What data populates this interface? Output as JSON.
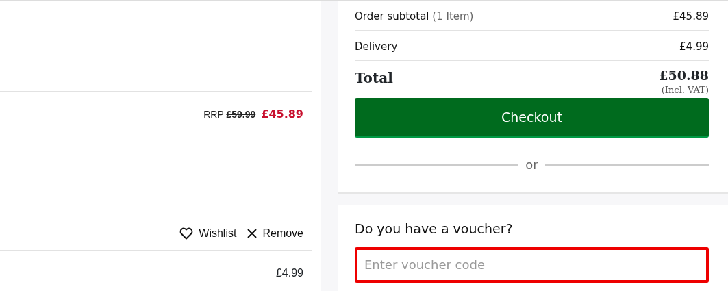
{
  "basket": {
    "item": {
      "rrp_label": "RRP",
      "rrp": "£59.99",
      "price": "£45.89",
      "actions": [
        {
          "kind": "wishlist",
          "label": "Wishlist"
        },
        {
          "kind": "remove",
          "label": "Remove"
        }
      ]
    },
    "delivery_price": "£4.99"
  },
  "summary": {
    "rows": [
      {
        "label": "Order subtotal",
        "note": "(1 Item)",
        "value": "£45.89"
      },
      {
        "label": "Delivery",
        "value": "£4.99"
      }
    ],
    "total": {
      "label": "Total",
      "value": "£50.88",
      "note": "(Incl. VAT)"
    },
    "checkout": "Checkout",
    "separator": "or"
  },
  "voucher": {
    "title": "Do you have a voucher?",
    "placeholder": "Enter voucher code",
    "invalid": true
  }
}
